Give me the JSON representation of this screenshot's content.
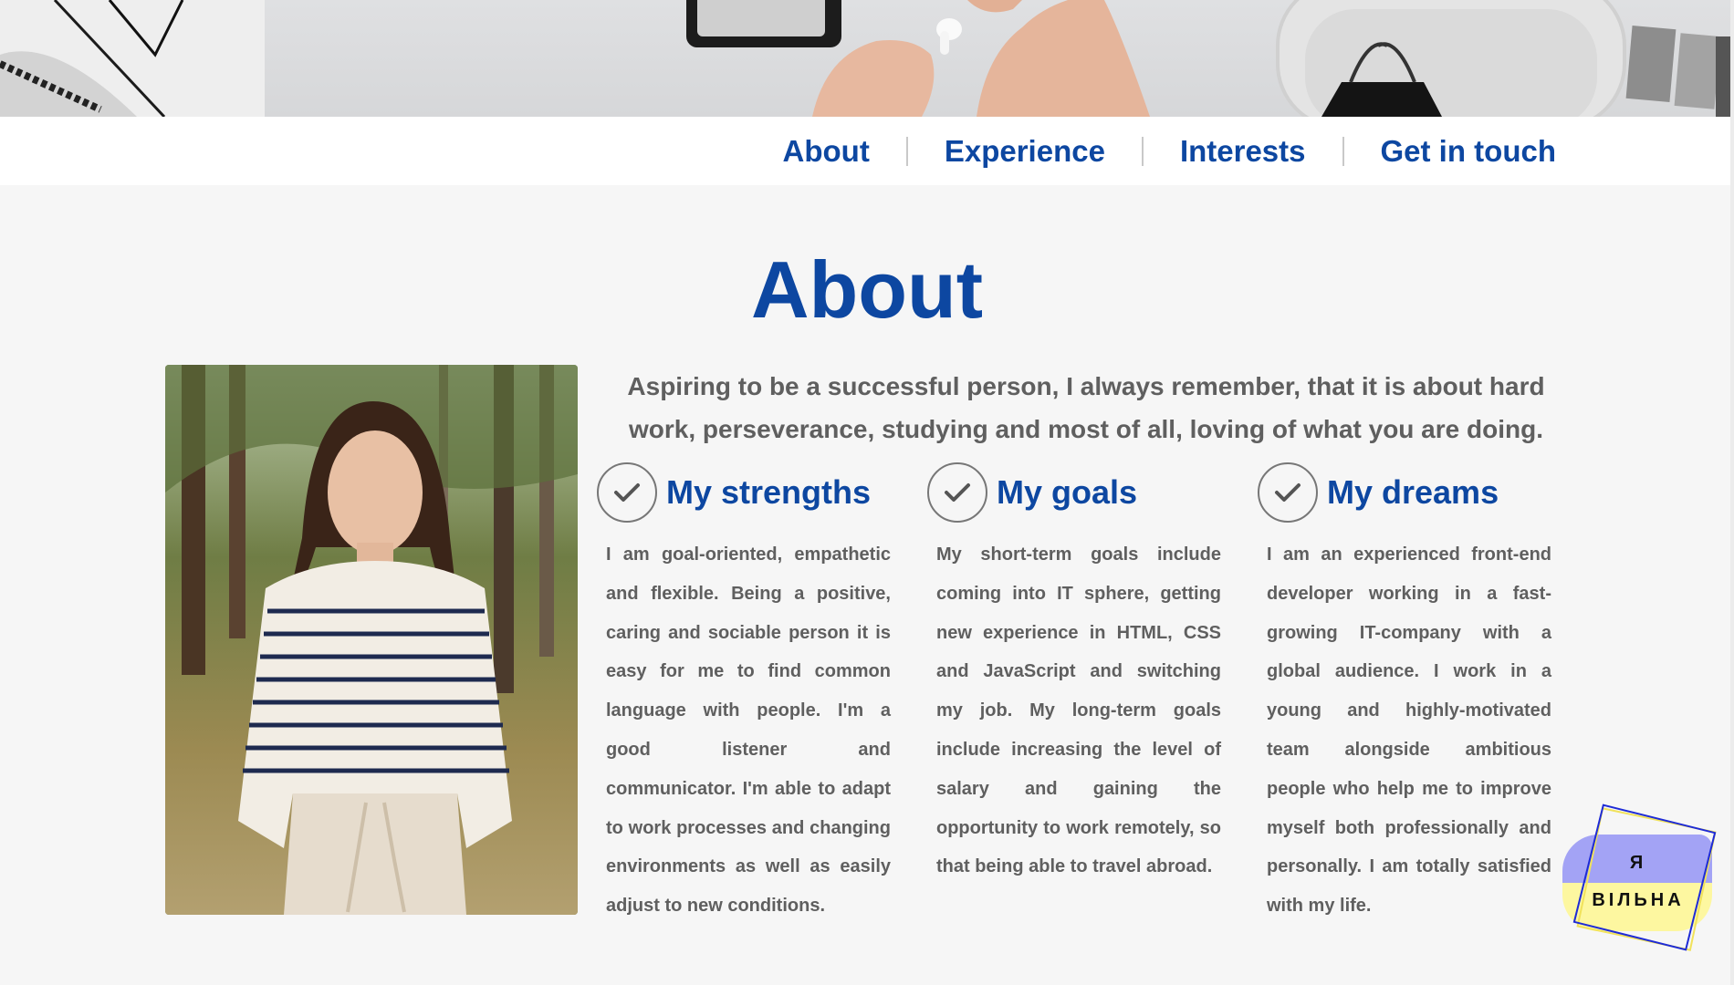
{
  "nav": {
    "items": [
      {
        "label": "About"
      },
      {
        "label": "Experience"
      },
      {
        "label": "Interests"
      },
      {
        "label": "Get in touch"
      }
    ]
  },
  "about": {
    "title": "About",
    "intro": "Aspiring to be a successful person, I always remember, that it is about hard work, perseverance, studying and most of all, loving of what you are doing.",
    "columns": [
      {
        "title": "My strengths",
        "icon": "check-circle-icon",
        "text": "I am goal-oriented, empathetic and flexible. Being a positive, caring and sociable person it is easy for me to find common language with people. I'm a good listener and communicator. I'm able to adapt to work processes and changing environments as well as easily adjust to new conditions."
      },
      {
        "title": "My goals",
        "icon": "check-circle-icon",
        "text": "My short-term goals include coming into IT sphere, getting new experience in HTML, CSS and JavaScript and switching my job. My long-term goals include increasing the level of salary and gaining the opportunity to work remotely, so that being able to travel abroad."
      },
      {
        "title": "My dreams",
        "icon": "check-circle-icon",
        "text": "I am an experienced front-end developer working in a fast-growing IT-company with a global audience. I work in a young and highly-motivated team alongside ambitious people who help me to improve myself both professionally and personally. I am totally satisfied with my life."
      }
    ]
  },
  "badge": {
    "line1": "Я",
    "line2": "ВІЛЬНА"
  },
  "colors": {
    "accent": "#0d47a1",
    "text": "#5f5f5f",
    "background": "#f6f6f6"
  }
}
